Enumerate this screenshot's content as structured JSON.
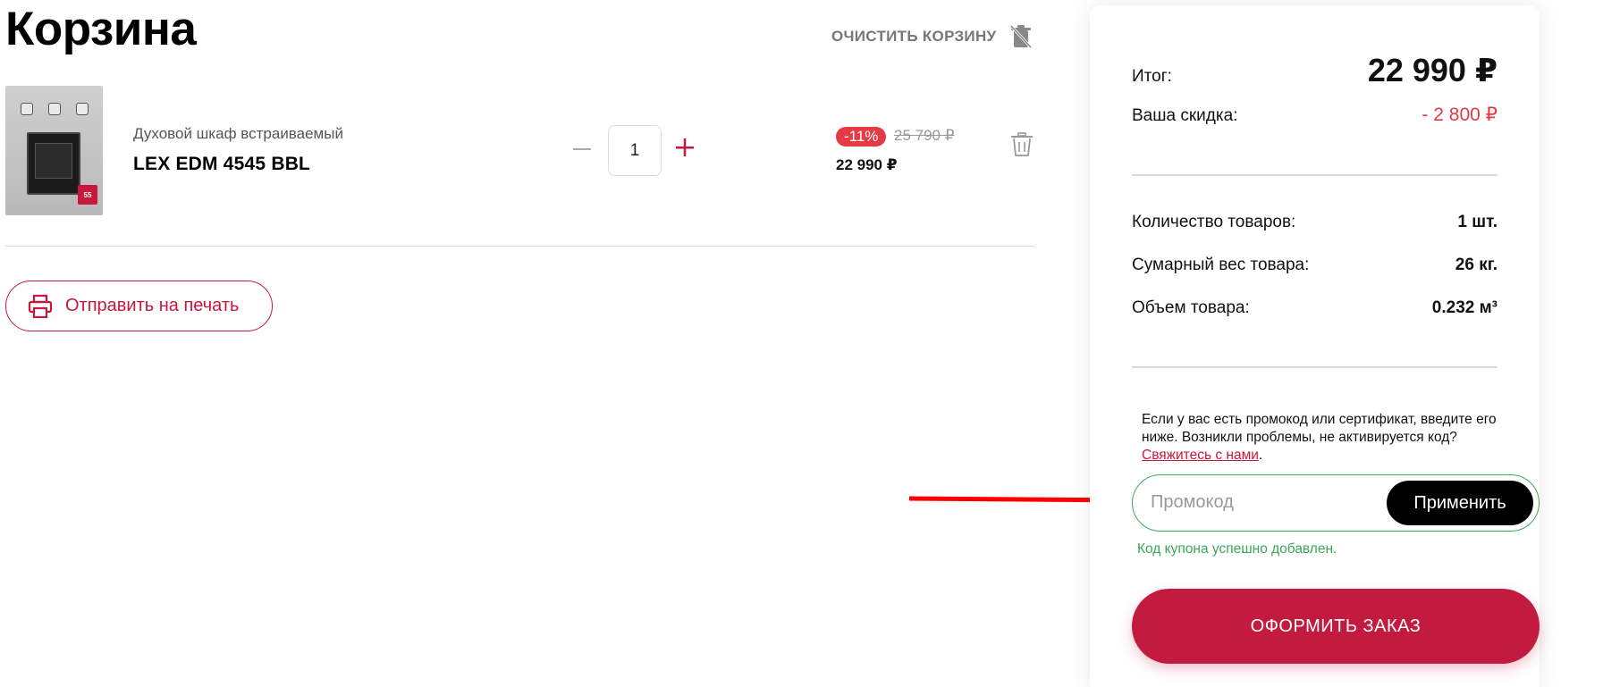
{
  "page": {
    "title": "Корзина"
  },
  "cart": {
    "clear_label": "ОЧИСТИТЬ КОРЗИНУ",
    "items": [
      {
        "type": "Духовой шкаф встраиваемый",
        "name": "LEX EDM 4545 BBL",
        "thumb_badge": "55",
        "quantity": "1",
        "discount": "-11%",
        "old_price": "25 790 ₽",
        "price": "22 990 ₽"
      }
    ],
    "print_label": "Отправить на печать"
  },
  "summary": {
    "total_label": "Итог:",
    "total_value": "22 990 ₽",
    "discount_label": "Ваша скидка:",
    "discount_value": "- 2 800 ₽",
    "count_label": "Количество товаров:",
    "count_value": "1 шт.",
    "weight_label": "Сумарный вес товара:",
    "weight_value": "26 кг.",
    "volume_label": "Объем товара:",
    "volume_value": "0.232 м³",
    "promo_note": "Если у вас есть промокод или сертификат, введите его ниже. Возникли проблемы, не активируется код?",
    "promo_link": "Свяжитесь с нами",
    "promo_placeholder": "Промокод",
    "apply_label": "Применить",
    "promo_success": "Код купона успешно добавлен.",
    "checkout_label": "ОФОРМИТЬ ЗАКАЗ"
  },
  "colors": {
    "accent": "#c8173c",
    "discount": "#e43a44",
    "success": "#3aa857",
    "annotation_arrow": "#ff0000"
  }
}
